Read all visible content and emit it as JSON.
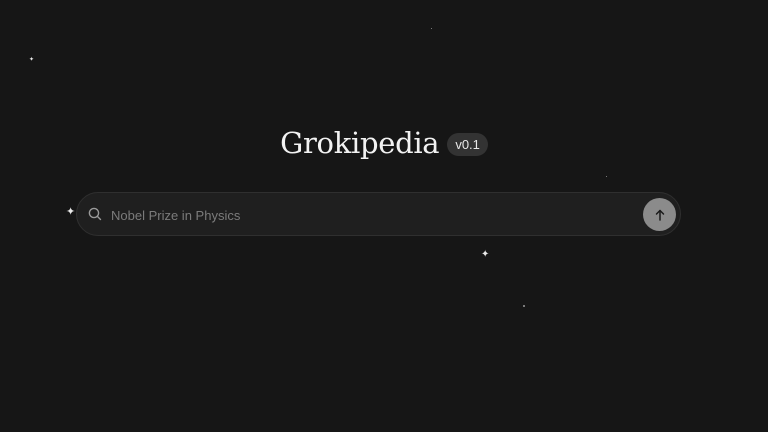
{
  "app": {
    "title": "Grokipedia",
    "version": "v0.1"
  },
  "search": {
    "placeholder": "Nobel Prize in Physics",
    "value": ""
  },
  "icons": {
    "search": "search-icon",
    "submit": "arrow-up-icon",
    "sparkle": "sparkle-icon"
  },
  "colors": {
    "background": "#161616",
    "search_bar": "#1f1f1f",
    "submit_button": "#8b8b8b",
    "badge": "#333333",
    "text": "#f2f2f2"
  }
}
